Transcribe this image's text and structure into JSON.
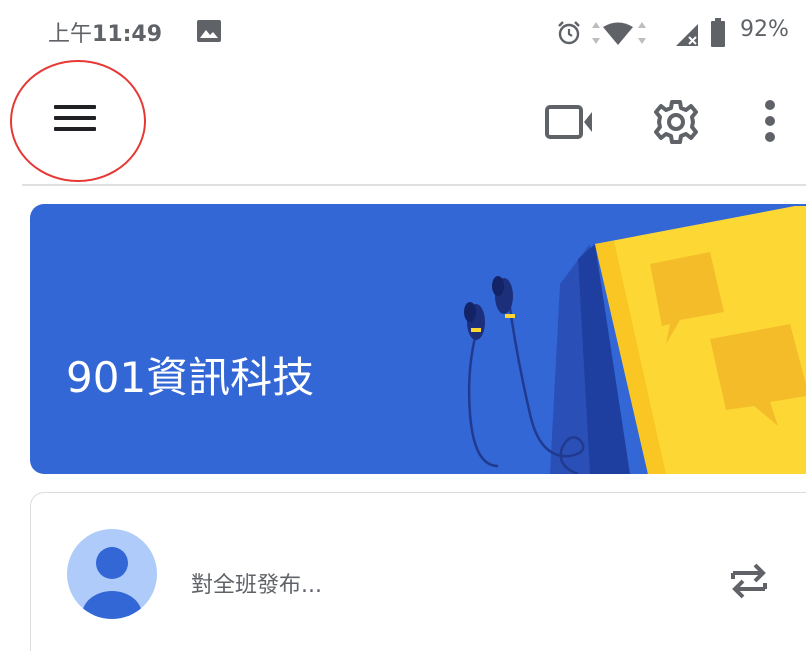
{
  "status_bar": {
    "time_prefix": "上午",
    "time": "11:49",
    "battery": "92%",
    "icons": [
      "image-icon",
      "alarm-icon",
      "data-arrows-icon",
      "wifi-icon",
      "cellular-no-service-icon",
      "battery-icon"
    ]
  },
  "app_bar": {
    "icons": [
      "menu-icon",
      "video-camera-icon",
      "gear-icon",
      "more-vert-icon"
    ]
  },
  "banner": {
    "class_name": "901資訊科技",
    "color": "#3367d6"
  },
  "post": {
    "placeholder": "對全班發布...",
    "icons": [
      "avatar-icon",
      "repost-icon"
    ]
  },
  "colors": {
    "accent": "#3367d6",
    "annotation": "#e53935",
    "icon_gray": "#5f6368",
    "book_yellow": "#fdd835"
  }
}
